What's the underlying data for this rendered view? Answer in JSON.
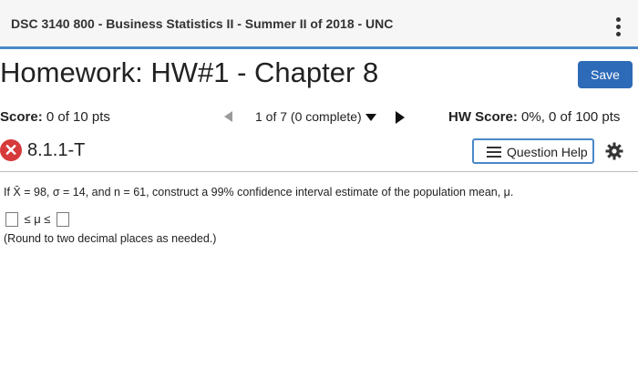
{
  "header": {
    "course_title": "DSC 3140 800 - Business Statistics II - Summer II of 2018 - UNC",
    "menu_icon": "vertical-dots-icon"
  },
  "homework": {
    "title": "Homework: HW#1 - Chapter 8",
    "save_label": "Save"
  },
  "score_bar": {
    "score_label": "Score:",
    "score_value": "0 of 10 pts",
    "position_text": "1 of 7 (0 complete)",
    "hw_score_label": "HW Score:",
    "hw_score_value": "0%, 0 of 100 pts"
  },
  "question_bar": {
    "status_icon": "incorrect-x-icon",
    "status_symbol": "✕",
    "question_id": "8.1.1-T",
    "help_label": "Question Help",
    "help_icon": "list-icon",
    "settings_icon": "gear-icon"
  },
  "question": {
    "prompt": "If X̄ = 98, σ = 14, and n = 61, construct a 99% confidence interval estimate of the population mean, μ.",
    "interval_symbol": "≤ μ ≤",
    "hint": "(Round to two decimal places as needed.)"
  },
  "colors": {
    "accent": "#4a88c8",
    "save_button": "#2d6ab8",
    "incorrect": "#d63a3a"
  }
}
